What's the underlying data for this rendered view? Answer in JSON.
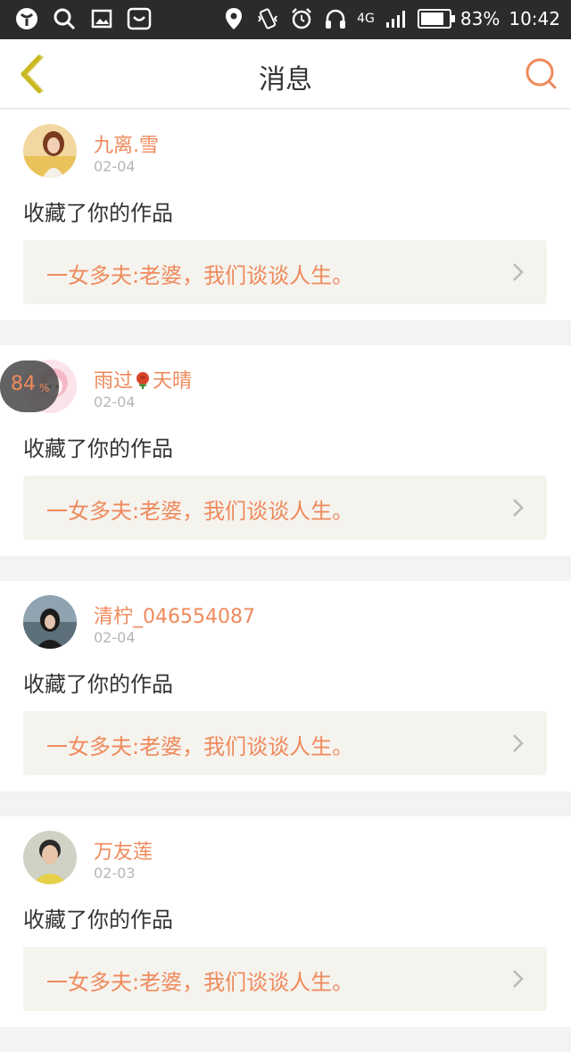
{
  "status_bar": {
    "network": "4G",
    "battery": "83%",
    "battery_level": 0.83,
    "time": "10:42"
  },
  "header": {
    "title": "消息"
  },
  "messages": [
    {
      "username": "九离.雪",
      "date": "02-04",
      "action": "收藏了你的作品",
      "work_title": "一女多夫:老婆，我们谈谈人生。"
    },
    {
      "username_a": "雨过",
      "username_b": "天晴",
      "date": "02-04",
      "action": "收藏了你的作品",
      "work_title": "一女多夫:老婆，我们谈谈人生。"
    },
    {
      "username": "清柠_046554087",
      "date": "02-04",
      "action": "收藏了你的作品",
      "work_title": "一女多夫:老婆，我们谈谈人生。"
    },
    {
      "username": "万友莲",
      "date": "02-03",
      "action": "收藏了你的作品",
      "work_title": "一女多夫:老婆，我们谈谈人生。"
    }
  ],
  "floating_badge": {
    "value": "84",
    "unit": "%"
  },
  "colors": {
    "accent": "#ef8a5c",
    "back_arrow": "#c9b820"
  }
}
